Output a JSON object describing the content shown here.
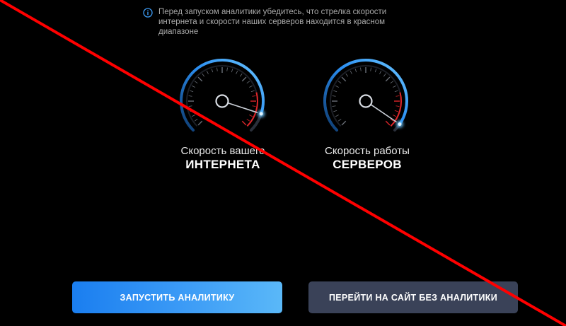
{
  "notice": {
    "icon": "info-icon",
    "text": "Перед запуском аналитики убедитесь, что стрелка скорости интернета и скорости наших серверов находится в красном диапазоне"
  },
  "gauges": {
    "internet": {
      "caption_line1": "Скорость вашего",
      "caption_line2": "ИНТЕРНЕТА",
      "level": 0.9
    },
    "servers": {
      "caption_line1": "Скорость работы",
      "caption_line2": "СЕРВЕРОВ",
      "level": 0.96
    }
  },
  "buttons": {
    "start_label": "ЗАПУСТИТЬ АНАЛИТИКУ",
    "skip_label": "ПЕРЕЙТИ НА САЙТ БЕЗ АНАЛИТИКИ"
  },
  "colors": {
    "background": "#000000",
    "accent": "#2b8ff2",
    "red_zone": "#e0262a",
    "skip_button": "#3a4258",
    "strike": "#ff0000"
  }
}
